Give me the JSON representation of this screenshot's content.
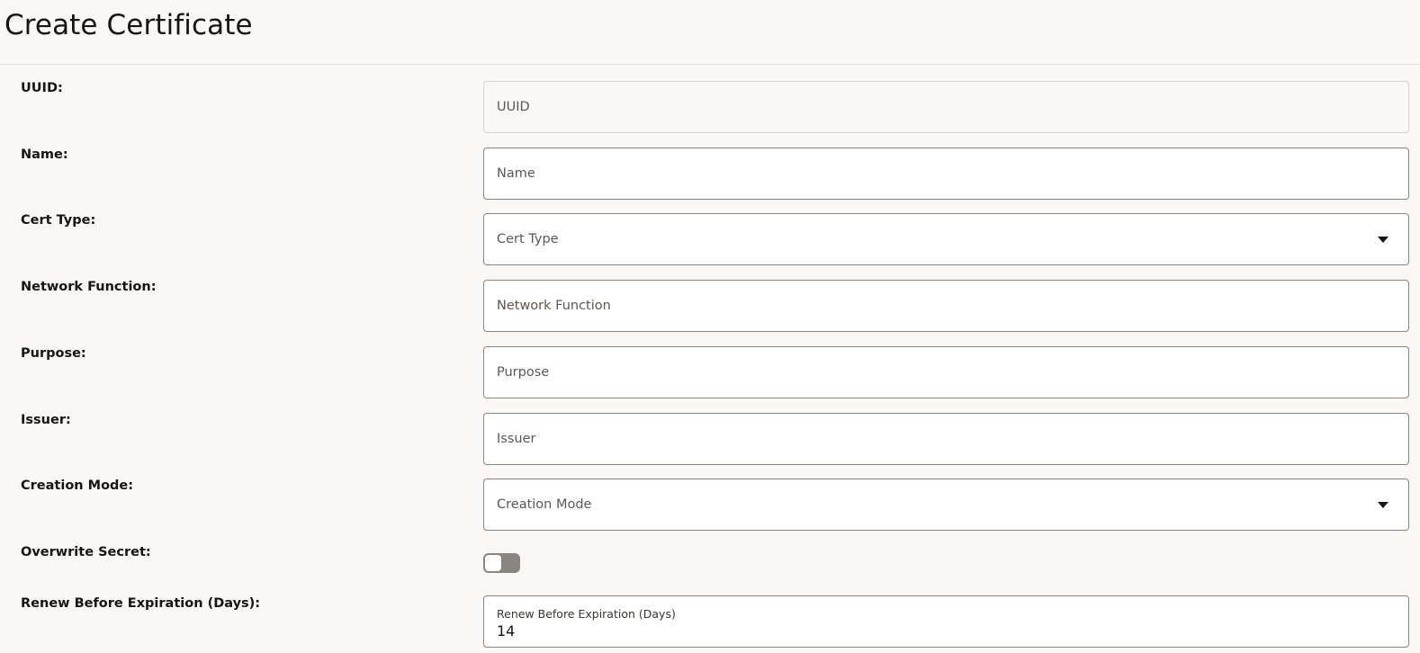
{
  "page": {
    "title": "Create Certificate"
  },
  "form": {
    "uuid": {
      "label": "UUID:",
      "placeholder": "UUID",
      "value": ""
    },
    "name": {
      "label": "Name:",
      "placeholder": "Name",
      "value": ""
    },
    "cert_type": {
      "label": "Cert Type:",
      "placeholder": "Cert Type",
      "options": []
    },
    "network_function": {
      "label": "Network Function:",
      "placeholder": "Network Function",
      "value": ""
    },
    "purpose": {
      "label": "Purpose:",
      "placeholder": "Purpose",
      "value": ""
    },
    "issuer": {
      "label": "Issuer:",
      "placeholder": "Issuer",
      "value": ""
    },
    "creation_mode": {
      "label": "Creation Mode:",
      "placeholder": "Creation Mode",
      "options": []
    },
    "overwrite_secret": {
      "label": "Overwrite Secret:",
      "checked": false
    },
    "renew_before_expiration": {
      "label": "Renew Before Expiration (Days):",
      "inner_label": "Renew Before Expiration (Days)",
      "value": "14"
    }
  },
  "icons": {
    "dropdown": "chevron-down-icon"
  },
  "colors": {
    "background": "#f9f8f6",
    "field_border": "#8b8580",
    "toggle_off": "#8b8580"
  }
}
